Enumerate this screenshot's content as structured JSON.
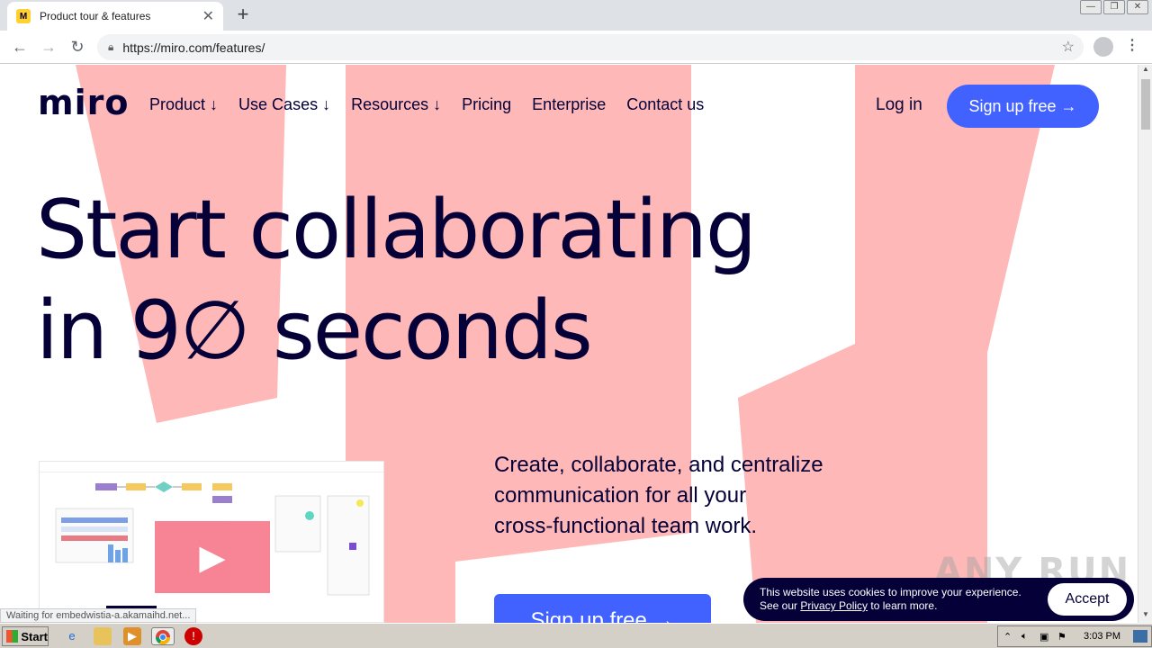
{
  "browser": {
    "tab_title": "Product tour & features",
    "tab_favicon": "M",
    "url": "https://miro.com/features/",
    "window_buttons": [
      "—",
      "❐",
      "✕"
    ]
  },
  "page": {
    "logo": "miro",
    "nav": [
      "Product ↓",
      "Use Cases ↓",
      "Resources ↓",
      "Pricing",
      "Enterprise",
      "Contact us"
    ],
    "login": "Log in",
    "signup_top": "Sign up free →",
    "hero_line1": "Start collaborating",
    "hero_line2": "in 9∅ seconds",
    "description_line1": "Create, collaborate, and centralize",
    "description_line2": "communication for all your",
    "description_line3": "cross-functional team work.",
    "signup_main": "Sign up free →",
    "status_text": "Waiting for embedwistia-a.akamaihd.net...",
    "watermark": "ANY RUN"
  },
  "cookie": {
    "line1": "This website uses cookies to improve your experience.",
    "line2_pre": "See our ",
    "link": "Privacy Policy",
    "line2_post": " to learn more.",
    "accept": "Accept"
  },
  "taskbar": {
    "start": "Start",
    "clock": "3:03 PM"
  },
  "colors": {
    "brand_navy": "#050038",
    "accent_blue": "#4262ff",
    "shape_pink": "#ffb8b8"
  }
}
